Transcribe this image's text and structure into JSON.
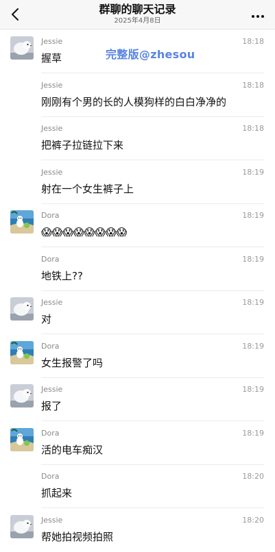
{
  "header": {
    "title": "群聊的聊天记录",
    "date": "2025年4月8日",
    "back_icon": "chevron-left-icon",
    "more_icon": "more-horizontal-icon"
  },
  "watermark": "完整版@zhesou",
  "avatars": {
    "Jessie": "bird-avatar",
    "Dora": "dog-beach-avatar"
  },
  "messages": [
    {
      "sender": "Jessie",
      "time": "18:18",
      "text": "握草",
      "show_avatar": true
    },
    {
      "sender": "Jessie",
      "time": "18:18",
      "text": "刚刚有个男的长的人模狗样的白白净净的",
      "show_avatar": false
    },
    {
      "sender": "Jessie",
      "time": "18:18",
      "text": "把裤子拉链拉下来",
      "show_avatar": false
    },
    {
      "sender": "Jessie",
      "time": "18:19",
      "text": "射在一个女生裤子上",
      "show_avatar": false
    },
    {
      "sender": "Dora",
      "time": "18:19",
      "text": "😱😱😱😱😱😱😱😱",
      "show_avatar": true
    },
    {
      "sender": "Dora",
      "time": "18:19",
      "text": "地铁上??",
      "show_avatar": false
    },
    {
      "sender": "Jessie",
      "time": "18:19",
      "text": "对",
      "show_avatar": true
    },
    {
      "sender": "Dora",
      "time": "18:19",
      "text": "女生报警了吗",
      "show_avatar": true
    },
    {
      "sender": "Jessie",
      "time": "18:19",
      "text": "报了",
      "show_avatar": true
    },
    {
      "sender": "Dora",
      "time": "18:19",
      "text": "活的电车痴汉",
      "show_avatar": true
    },
    {
      "sender": "Dora",
      "time": "18:20",
      "text": "抓起来",
      "show_avatar": false
    },
    {
      "sender": "Jessie",
      "time": "18:20",
      "text": "帮她拍视频拍照",
      "show_avatar": true
    }
  ]
}
